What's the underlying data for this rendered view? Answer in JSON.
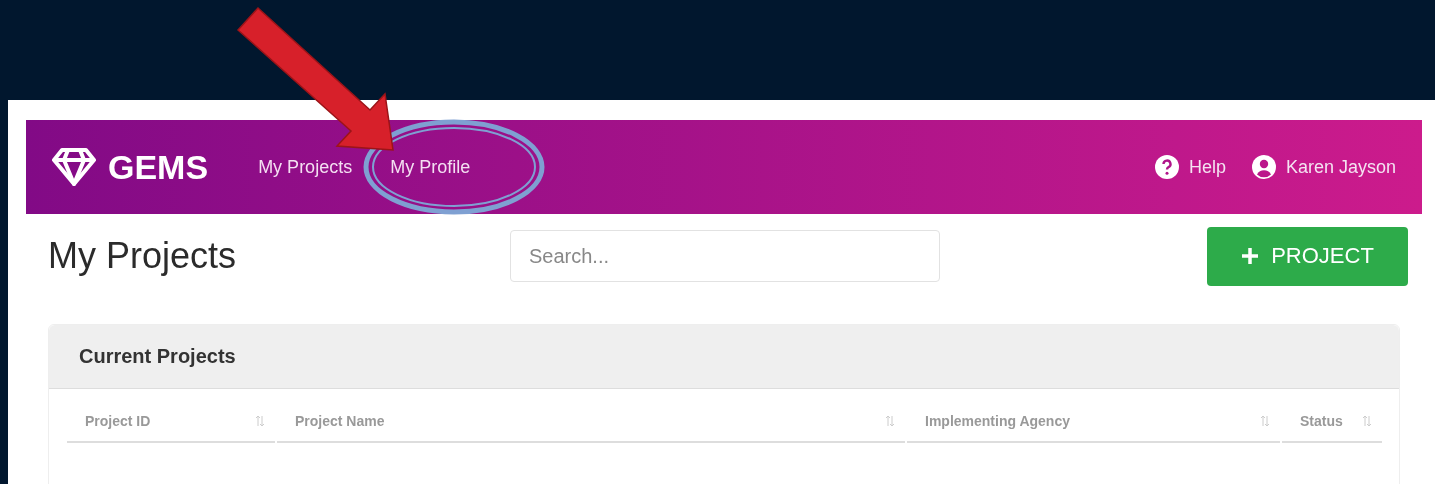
{
  "header": {
    "logo": "GEMS",
    "nav": [
      "My Projects",
      "My Profile"
    ],
    "help": "Help",
    "user": "Karen Jayson"
  },
  "page": {
    "title": "My Projects",
    "search": {
      "placeholder": "Search..."
    },
    "add_button": "PROJECT"
  },
  "card": {
    "title": "Current Projects",
    "columns": [
      "Project ID",
      "Project Name",
      "Implementing Agency",
      "Status"
    ]
  }
}
